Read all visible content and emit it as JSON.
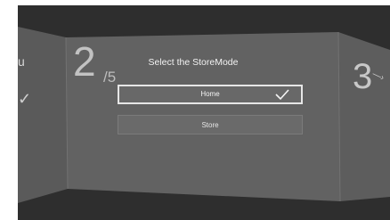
{
  "wizard": {
    "step_current": "2",
    "step_total": "/5",
    "title": "Select the StoreMode",
    "options": [
      {
        "label": "Home",
        "selected": true
      },
      {
        "label": "Store",
        "selected": false
      }
    ],
    "next_step_number": "3"
  },
  "colors": {
    "screen_bg": "#2e2e2e",
    "panel_bg": "#6a6a6a",
    "selected_border": "#e6e6e6",
    "text": "#f2f2f2"
  },
  "icons": {
    "selected_indicator": "check-icon",
    "prev_panel_mark": "check-icon",
    "next_panel_mark": "arrow-icon"
  }
}
